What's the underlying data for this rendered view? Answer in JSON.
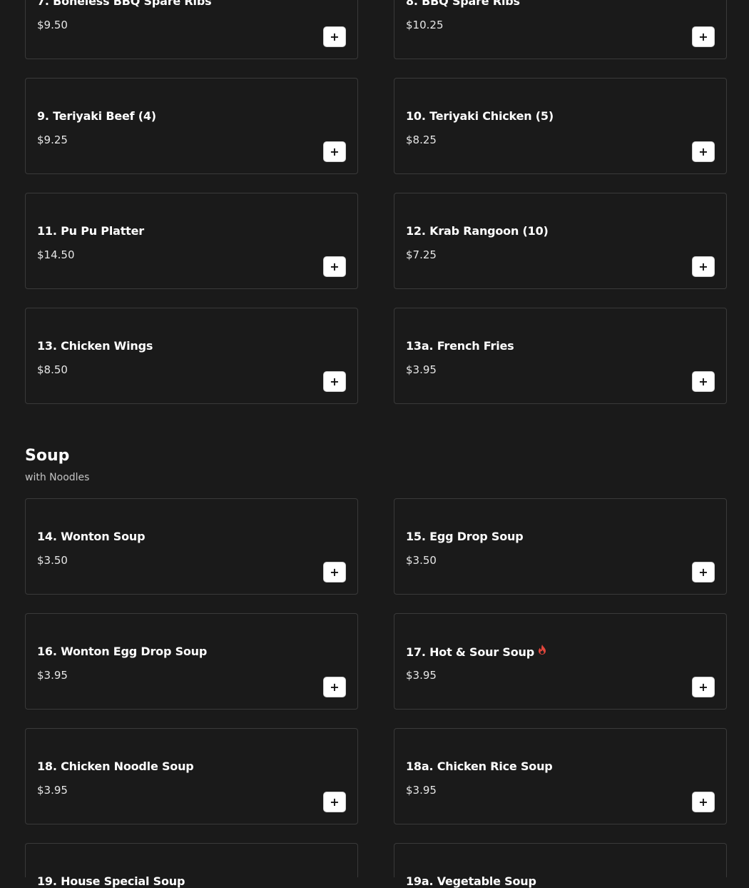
{
  "colors": {
    "background": "#1a1a1a",
    "card_border": "#3a3a3a",
    "add_button": "#ffffff",
    "spicy": "#e2463c"
  },
  "top_items": [
    {
      "name": "7. Boneless BBQ Spare Ribs",
      "price": "$9.50"
    },
    {
      "name": "8. BBQ Spare Ribs",
      "price": "$10.25"
    },
    {
      "name": "9. Teriyaki Beef (4)",
      "price": "$9.25"
    },
    {
      "name": "10. Teriyaki Chicken (5)",
      "price": "$8.25"
    },
    {
      "name": "11. Pu Pu Platter",
      "price": "$14.50"
    },
    {
      "name": "12. Krab Rangoon (10)",
      "price": "$7.25"
    },
    {
      "name": "13. Chicken Wings",
      "price": "$8.50"
    },
    {
      "name": "13a. French Fries",
      "price": "$3.95"
    }
  ],
  "soup_section": {
    "title": "Soup",
    "subtitle": "with Noodles",
    "items": [
      {
        "name": "14. Wonton Soup",
        "price": "$3.50"
      },
      {
        "name": "15. Egg Drop Soup",
        "price": "$3.50"
      },
      {
        "name": "16. Wonton Egg Drop Soup",
        "price": "$3.95"
      },
      {
        "name": "17. Hot & Sour Soup",
        "price": "$3.95",
        "icon": "spicy-flame-icon"
      },
      {
        "name": "18. Chicken Noodle Soup",
        "price": "$3.95"
      },
      {
        "name": "18a. Chicken Rice Soup",
        "price": "$3.95"
      },
      {
        "name": "19. House Special Soup",
        "price": ""
      },
      {
        "name": "19a. Vegetable Soup",
        "price": ""
      }
    ]
  },
  "add_button_label": "+"
}
